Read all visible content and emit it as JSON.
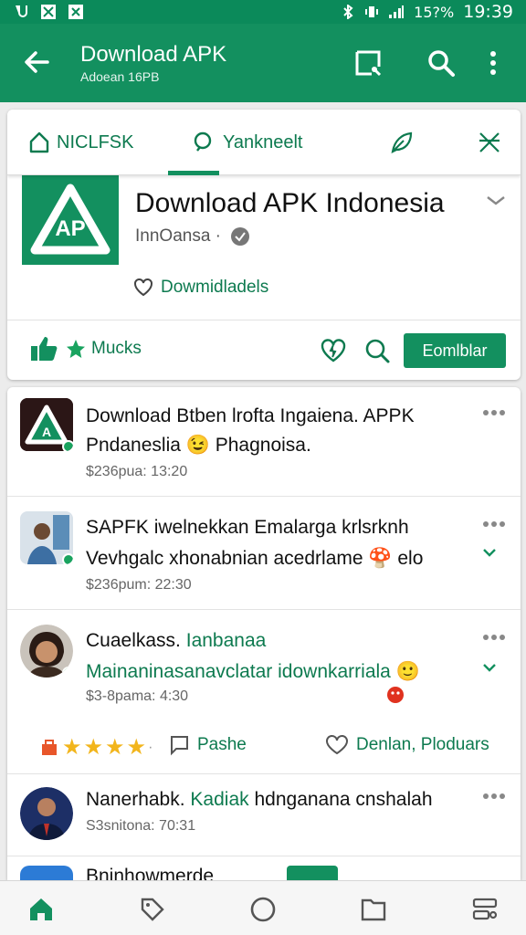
{
  "status_bar": {
    "left_icons": [
      "notification-icon",
      "image-icon",
      "close-box-icon"
    ],
    "battery_text": "15?%",
    "time": "19:39"
  },
  "app_bar": {
    "title": "Download APK",
    "subtitle": "Adoean 16PB"
  },
  "tabs": [
    {
      "label": "NICLFSK",
      "icon": "home-outline-icon"
    },
    {
      "label": "Yankneelt",
      "icon": "search-icon"
    },
    {
      "label": "",
      "icon": "leaf-icon"
    },
    {
      "label": "",
      "icon": "close-x-icon"
    }
  ],
  "app": {
    "icon_text": "AP",
    "name": "Download APK Indonesia",
    "developer": "InnOansa ·",
    "downloads_label": "Dowmidladels",
    "likes_label": "Mucks",
    "download_button": "Eomlblar"
  },
  "posts": [
    {
      "line1": "Download Btben lrofta Ingaiena. APPK",
      "line2": "Pndaneslia 😉 Phagnoisa.",
      "time": "$236pua: 13:20"
    },
    {
      "line1": "SAPFK iwelnekkan Emalarga krlsrknh",
      "line2": "Vevhgalc xhonabnian acedrlame 🍄 elo",
      "time": "$236pum: 22:30"
    },
    {
      "line1_a": "Cuaelkass.",
      "line1_b": "Ianbanaa",
      "line2": "Mainaninasanavclatar idownkarriala 🙂",
      "time": "$3-8pama: 4:30"
    },
    {
      "line1_a": "Nanerhabk.",
      "line1_b": "Kadiak",
      "line1_c": "hdnganana cnshalah",
      "time": "S3snitona: 70:31"
    },
    {
      "line1": "Bninhowmerde"
    }
  ],
  "rating_row": {
    "share_label": "Pashe",
    "save_label": "Denlan, Ploduars"
  },
  "colors": {
    "brand": "#13905f",
    "accent_text": "#0d7a4f",
    "star": "#f2b51c"
  }
}
